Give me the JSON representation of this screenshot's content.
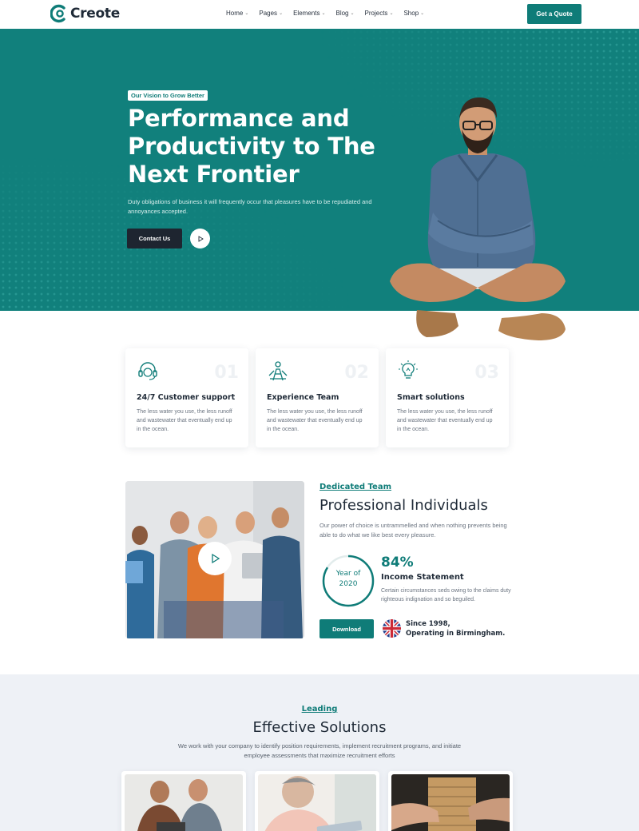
{
  "brand": {
    "name": "Creote",
    "accent": "#0f7c78",
    "dark": "#1e2530"
  },
  "nav": {
    "items": [
      {
        "label": "Home"
      },
      {
        "label": "Pages"
      },
      {
        "label": "Elements"
      },
      {
        "label": "Blog"
      },
      {
        "label": "Projects"
      },
      {
        "label": "Shop"
      }
    ],
    "cta": "Get a Quote"
  },
  "hero": {
    "tag": "Our Vision to Grow Better",
    "title": "Performance and Productivity to The Next Frontier",
    "subtitle": "Duty obligations of business it will frequently occur that pleasures have to be repudiated and annoyances accepted.",
    "primary_button": "Contact Us"
  },
  "features": [
    {
      "num": "01",
      "icon": "headset-icon",
      "title": "24/7 Customer support",
      "desc": "The less water you use, the less runoff and wastewater that eventually end up in the ocean."
    },
    {
      "num": "02",
      "icon": "team-icon",
      "title": "Experience Team",
      "desc": "The less water you use, the less runoff and wastewater that eventually end up in the ocean."
    },
    {
      "num": "03",
      "icon": "lightbulb-icon",
      "title": "Smart solutions",
      "desc": "The less water you use, the less runoff and wastewater that eventually end up in the ocean."
    }
  ],
  "about": {
    "subtitle": "Dedicated Team",
    "title": "Professional Individuals",
    "text": "Our power of choice is untrammelled and when nothing prevents being able to do what we like best every pleasure.",
    "year_line1": "Year of",
    "year_line2": "2020",
    "stat_percent": "84%",
    "stat_value": 0.84,
    "stat_title": "Income Statement",
    "stat_text": "Certain circumstances seds owing to the claims duty righteous indignation and so beguiled.",
    "download": "Download",
    "since_line1": "Since 1998,",
    "since_line2": "Operating in Birmingham."
  },
  "solutions": {
    "subtitle": "Leading",
    "title": "Effective Solutions",
    "text": "We work with your company to identify position requirements, implement recruitment programs, and initiate employee assessments that maximize recruitment efforts"
  }
}
